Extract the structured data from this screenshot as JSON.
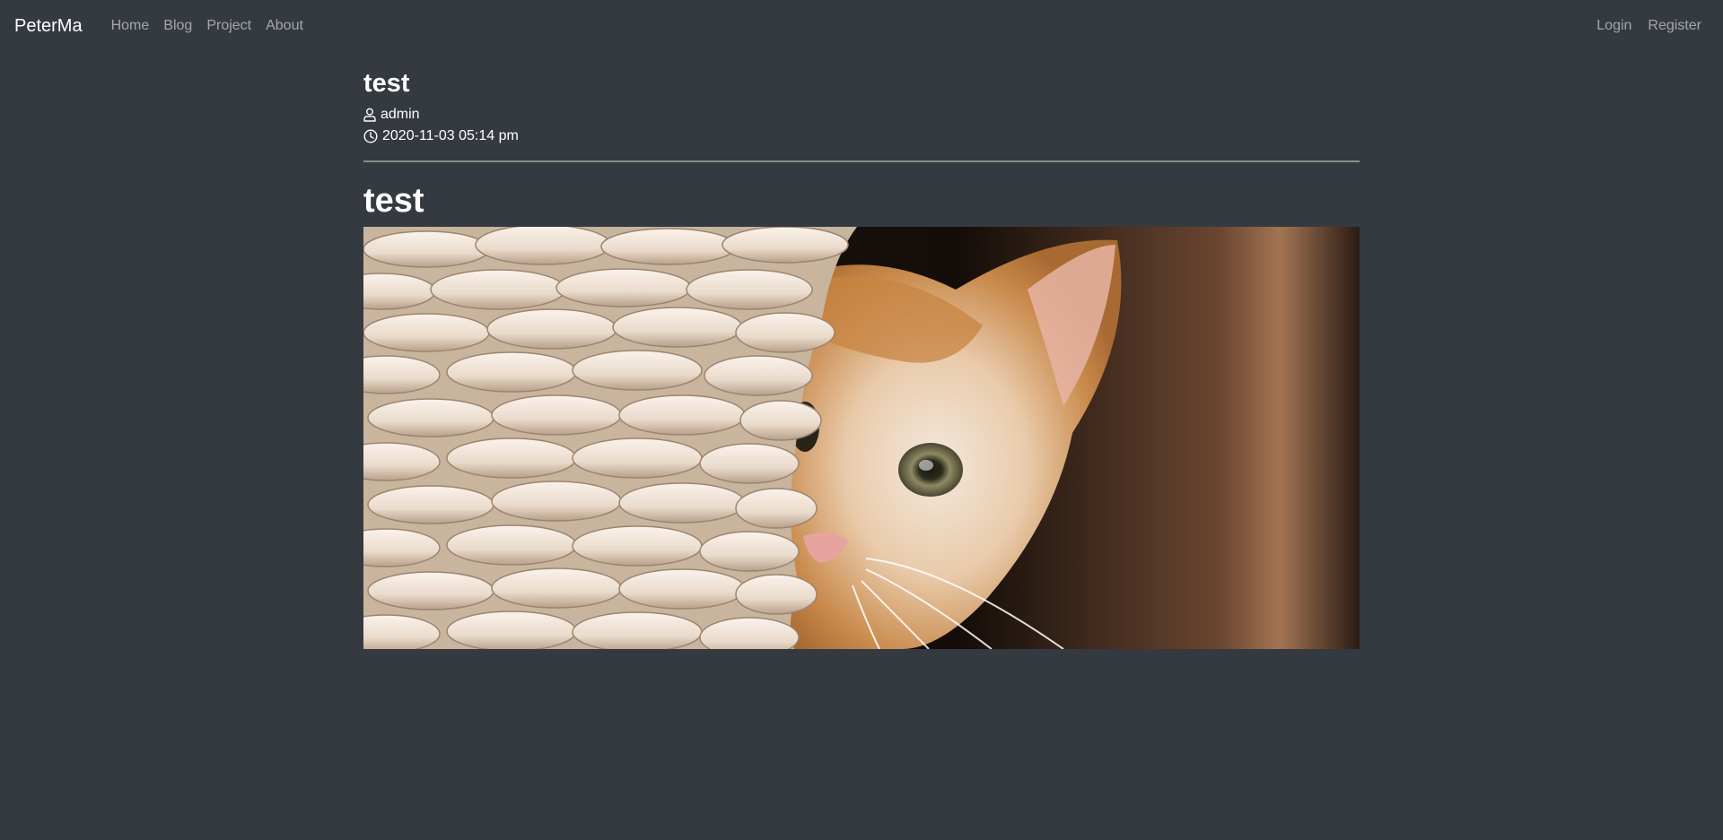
{
  "navbar": {
    "brand": "PeterMa",
    "links": [
      "Home",
      "Blog",
      "Project",
      "About"
    ],
    "auth": [
      "Login",
      "Register"
    ]
  },
  "post": {
    "title": "test",
    "author": "admin",
    "date": "2020-11-03 05:14 pm",
    "heading": "test"
  },
  "icons": {
    "author": "user-icon",
    "date": "clock-icon"
  },
  "colors": {
    "background": "#343a40",
    "divider": "#8a8f87",
    "nav_link": "rgba(255,255,255,0.55)"
  }
}
